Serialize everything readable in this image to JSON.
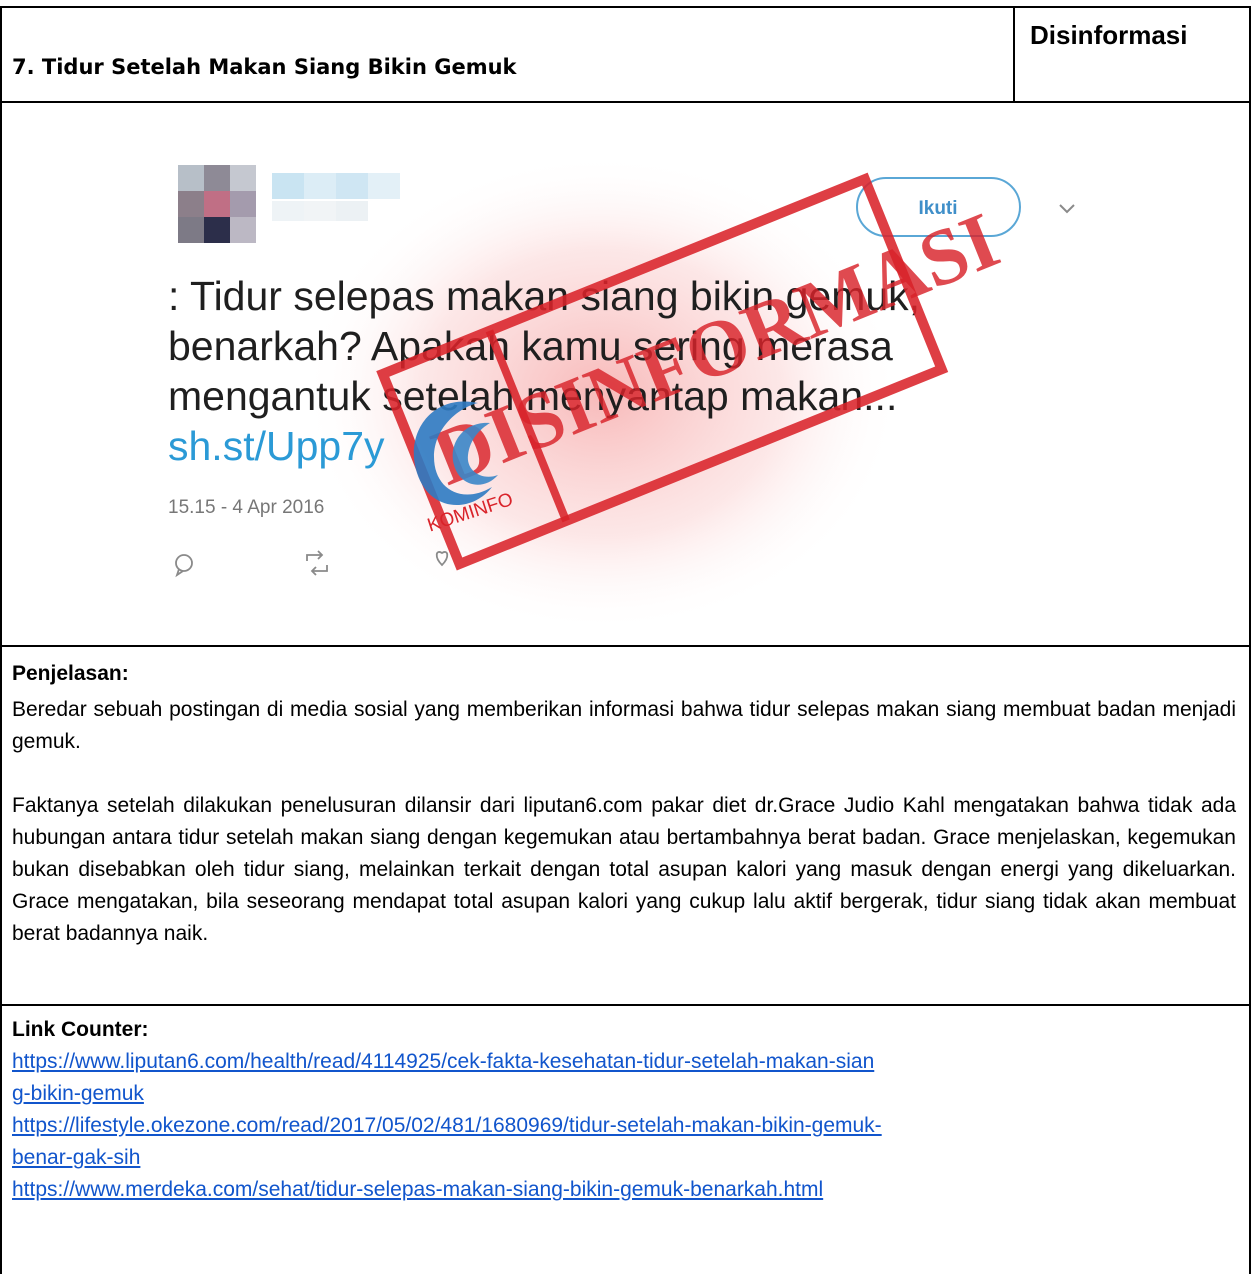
{
  "header": {
    "title": "7. Tidur Setelah Makan Siang Bikin Gemuk",
    "label": "Disinformasi"
  },
  "tweet": {
    "follow_label": "Ikuti",
    "text_lines": [
      ": Tidur selepas makan siang bikin gemuk,",
      "benarkah? Apakah kamu sering merasa",
      "mengantuk setelah menyantap makan..."
    ],
    "link": "sh.st/Upp7y",
    "timestamp": "15.15 - 4 Apr 2016"
  },
  "stamp": {
    "text": "DISINFORMASI",
    "logo_text": "KOMINFO",
    "color": "#d9232a"
  },
  "explanation": {
    "heading": "Penjelasan:",
    "paragraphs": [
      "Beredar sebuah postingan di media sosial yang memberikan informasi bahwa tidur selepas makan siang membuat badan menjadi gemuk.",
      "Faktanya setelah dilakukan penelusuran dilansir dari liputan6.com pakar diet dr.Grace Judio Kahl mengatakan bahwa tidak ada hubungan antara tidur setelah makan siang dengan kegemukan atau bertambahnya berat badan. Grace menjelaskan, kegemukan bukan disebabkan oleh tidur siang, melainkan terkait dengan total asupan kalori yang masuk dengan energi yang dikeluarkan. Grace mengatakan, bila seseorang mendapat total asupan kalori yang cukup lalu aktif bergerak, tidur siang tidak akan membuat berat badannya naik."
    ]
  },
  "counter": {
    "heading": "Link Counter:",
    "links": [
      [
        "https://www.liputan6.com/health/read/4114925/cek-fakta-kesehatan-tidur-setelah-makan-sian",
        "g-bikin-gemuk"
      ],
      [
        "https://lifestyle.okezone.com/read/2017/05/02/481/1680969/tidur-setelah-makan-bikin-gemuk-",
        "benar-gak-sih"
      ],
      [
        "https://www.merdeka.com/sehat/tidur-selepas-makan-siang-bikin-gemuk-benarkah.html"
      ]
    ]
  }
}
